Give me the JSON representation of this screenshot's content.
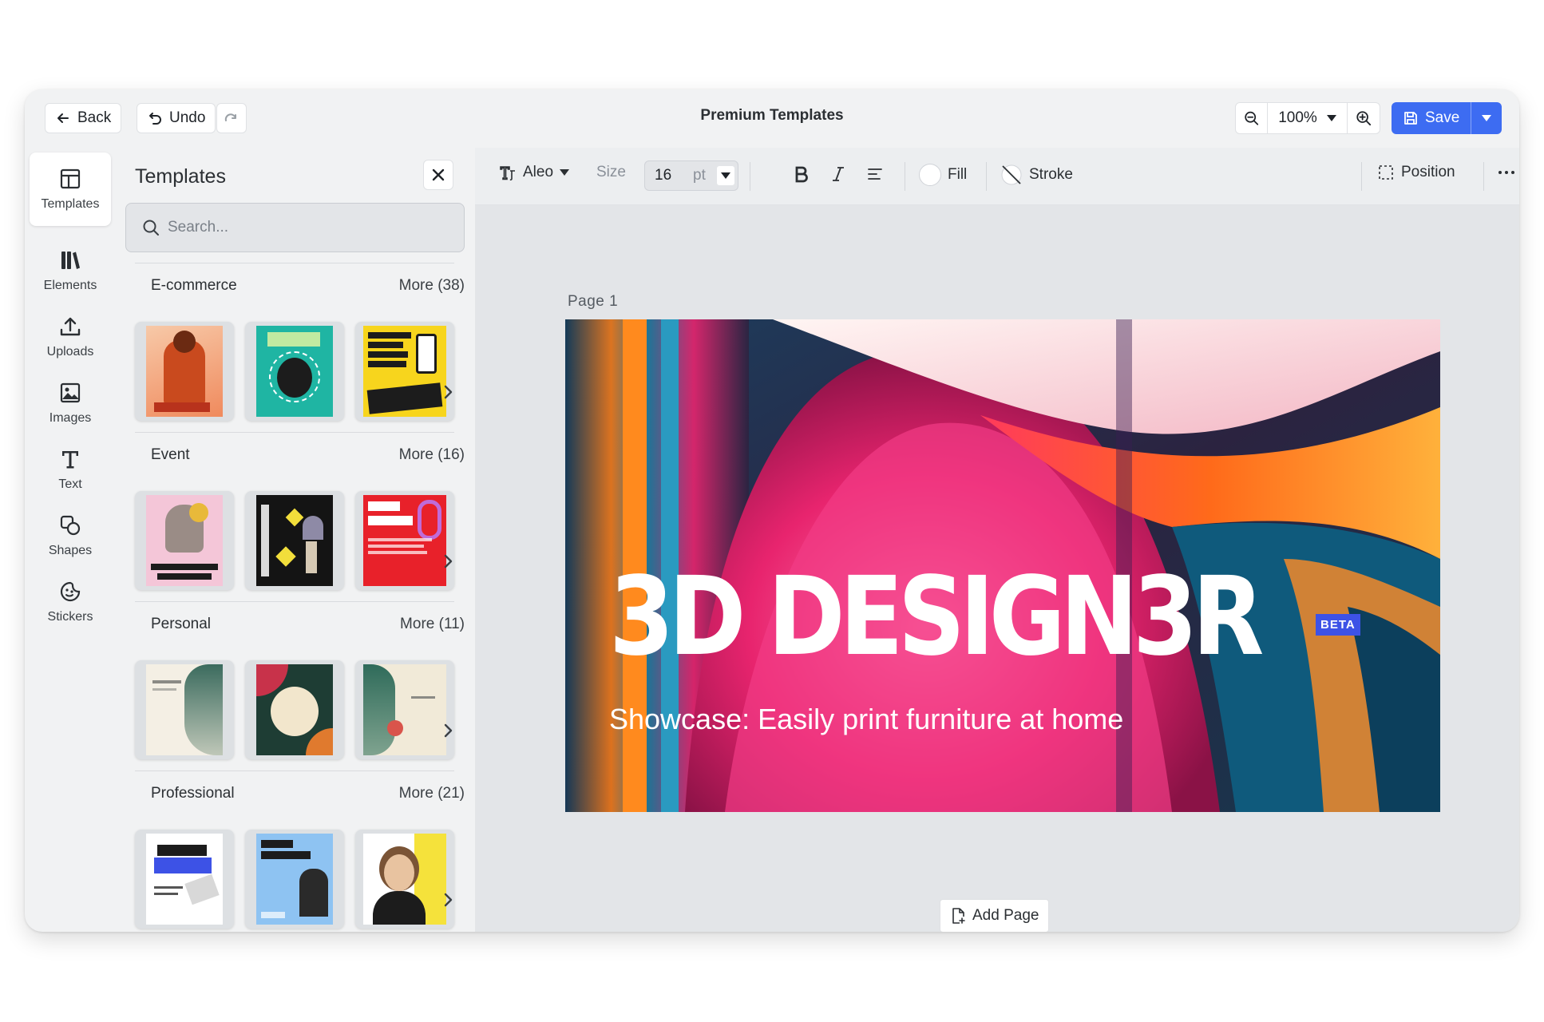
{
  "topbar": {
    "back_label": "Back",
    "undo_label": "Undo",
    "title": "Premium Templates",
    "zoom_value": "100%",
    "save_label": "Save"
  },
  "rail": {
    "items": [
      {
        "label": "Templates",
        "icon": "layout-icon"
      },
      {
        "label": "Elements",
        "icon": "library-icon"
      },
      {
        "label": "Uploads",
        "icon": "upload-icon"
      },
      {
        "label": "Images",
        "icon": "image-icon"
      },
      {
        "label": "Text",
        "icon": "text-icon"
      },
      {
        "label": "Shapes",
        "icon": "shapes-icon"
      },
      {
        "label": "Stickers",
        "icon": "sticker-icon"
      }
    ]
  },
  "panel": {
    "title": "Templates",
    "search_placeholder": "Search...",
    "categories": [
      {
        "name": "E-commerce",
        "more": "More (38)"
      },
      {
        "name": "Event",
        "more": "More (16)"
      },
      {
        "name": "Personal",
        "more": "More (11)"
      },
      {
        "name": "Professional",
        "more": "More (21)"
      }
    ]
  },
  "format": {
    "font": "Aleo",
    "size_label": "Size",
    "size_value": "16",
    "size_unit": "pt",
    "fill_label": "Fill",
    "stroke_label": "Stroke",
    "position_label": "Position"
  },
  "canvas": {
    "page_label": "Page 1",
    "headline": "3D DESIGN3R",
    "badge": "BETA",
    "subtitle": "Showcase: Easily print furniture at home",
    "add_page_label": "Add Page"
  },
  "colors": {
    "accent": "#3d6cf2",
    "badge": "#3d52e6"
  }
}
